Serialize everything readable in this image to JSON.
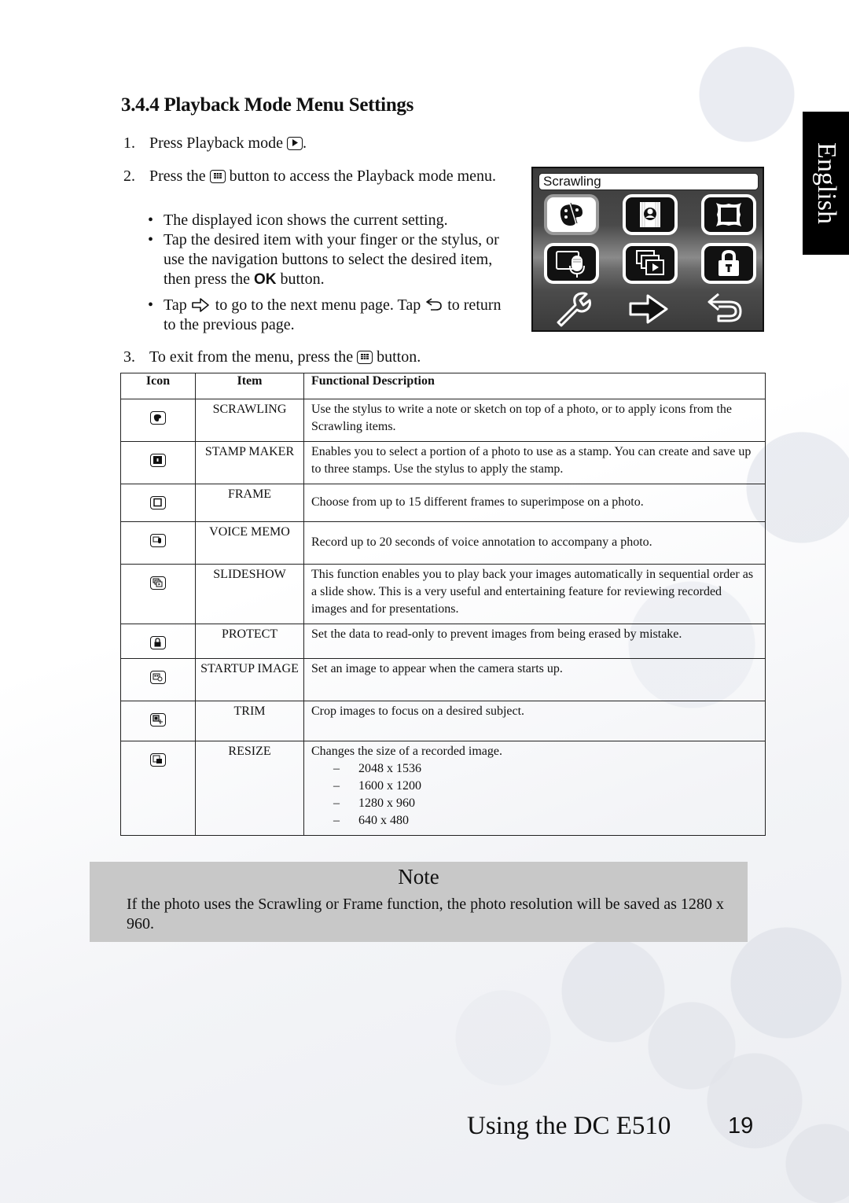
{
  "section": {
    "number": "3.4.4",
    "title": "3.4.4 Playback Mode Menu Settings"
  },
  "language_tab": "English",
  "steps": [
    {
      "num": "1.",
      "text_before": "Press Playback mode",
      "icon": "playback-icon",
      "text_after": "."
    },
    {
      "num": "2.",
      "text_before": "Press the",
      "icon": "menu-button-icon",
      "text_after": "button to access the Playback mode menu."
    },
    {
      "num": "3.",
      "text_before": "To exit from the menu, press the",
      "icon": "menu-button-icon",
      "text_after": "button."
    }
  ],
  "bullets": [
    {
      "text": "The displayed icon shows the current setting."
    },
    {
      "text_before": "Tap the desired item with your finger or the stylus, or use the navigation buttons to select the desired item, then press the",
      "ok": "OK",
      "text_after": "button."
    },
    {
      "text_a": "Tap",
      "icon_a": "next-page-arrow-icon",
      "text_b": "to go to the next menu page. Tap",
      "icon_b": "return-arrow-icon",
      "text_c": "to return to the previous page."
    }
  ],
  "camera_screen": {
    "title": "Scrawling",
    "buttons": [
      {
        "name": "scrawling",
        "icon": "palette-icon",
        "selected": true
      },
      {
        "name": "stamp-maker",
        "icon": "stamp-portrait-icon",
        "selected": false
      },
      {
        "name": "frame",
        "icon": "frame-icon",
        "selected": false
      },
      {
        "name": "voice-memo",
        "icon": "microphone-icon",
        "selected": false
      },
      {
        "name": "slideshow",
        "icon": "slideshow-icon",
        "selected": false
      },
      {
        "name": "protect",
        "icon": "lock-icon",
        "selected": false
      }
    ],
    "nav": [
      "wrench-icon",
      "next-arrow-icon",
      "return-icon"
    ]
  },
  "table": {
    "headers": [
      "Icon",
      "Item",
      "Functional Description"
    ],
    "rows": [
      {
        "icon": "scrawling-icon",
        "item": "SCRAWLING",
        "description": "Use the stylus to write a note or sketch on top of a photo, or to apply icons from the Scrawling items."
      },
      {
        "icon": "stamp-maker-icon",
        "item": "STAMP MAKER",
        "description": "Enables you to select a portion of a photo to use as a stamp. You can create and save up to three stamps. Use the stylus to apply the stamp."
      },
      {
        "icon": "frame-icon",
        "item": "FRAME",
        "description": "Choose from up to 15 different frames to superimpose on a photo."
      },
      {
        "icon": "voice-memo-icon",
        "item": "VOICE MEMO",
        "description": "Record up to 20 seconds of voice annotation to accompany a photo."
      },
      {
        "icon": "slideshow-icon",
        "item": "SLIDESHOW",
        "description": "This function enables you to play back your images automatically in sequential order as a slide show. This is a very useful and entertaining feature for reviewing recorded images and for presentations."
      },
      {
        "icon": "protect-icon",
        "item": "PROTECT",
        "description": "Set the data to read-only to prevent images from being erased by mistake."
      },
      {
        "icon": "startup-image-icon",
        "item": "STARTUP IMAGE",
        "description": "Set an image to appear when the camera starts up."
      },
      {
        "icon": "trim-icon",
        "item": "TRIM",
        "description": "Crop images to focus on a desired subject."
      },
      {
        "icon": "resize-icon",
        "item": "RESIZE",
        "description": "Changes the size of a recorded image.",
        "sizes": [
          "2048 x 1536",
          "1600 x 1200",
          "1280 x 960",
          "640 x 480"
        ]
      }
    ]
  },
  "note": {
    "title": "Note",
    "text": "If the photo uses the Scrawling or Frame function, the photo resolution will be saved as 1280 x 960."
  },
  "footer": {
    "title": "Using the DC E510",
    "page_number": "19"
  }
}
